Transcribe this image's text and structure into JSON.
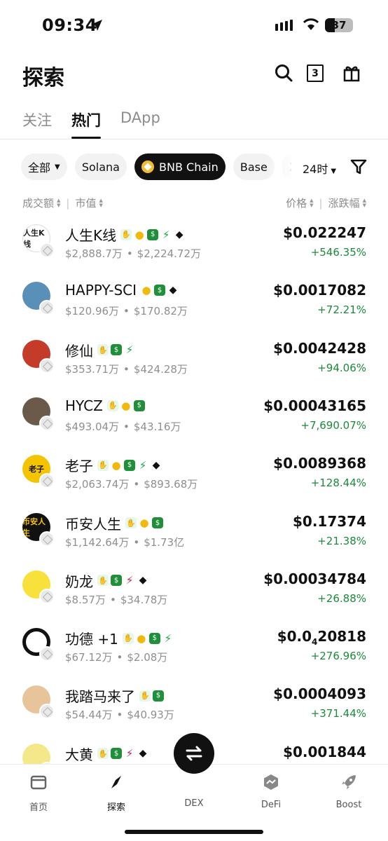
{
  "status_bar": {
    "time": "09:34",
    "battery": "37"
  },
  "header": {
    "title": "探索",
    "notification_count": "3"
  },
  "tabs": [
    {
      "label": "关注",
      "active": false
    },
    {
      "label": "热门",
      "active": true
    },
    {
      "label": "DApp",
      "active": false
    }
  ],
  "chips": [
    {
      "label": "全部"
    },
    {
      "label": "Solana"
    },
    {
      "label": "BNB Chain"
    },
    {
      "label": "Base"
    },
    {
      "label": "X"
    }
  ],
  "timeframe": "24时",
  "columns": {
    "volume": "成交额",
    "mcap": "市值",
    "price": "价格",
    "change": "涨跌幅"
  },
  "tokens": [
    {
      "name": "人生K线",
      "volume": "$2,888.7万",
      "mcap": "$2,224.72万",
      "price_main": "$0.022247",
      "price_sub": "",
      "price_tail": "",
      "change": "+546.35%",
      "avatar_text": "人生K线",
      "tags": [
        "hand-icon",
        "chef-hat-icon",
        "money-bag-icon",
        "bolt-icon",
        "owl-icon"
      ]
    },
    {
      "name": "HAPPY-SCI",
      "volume": "$120.96万",
      "mcap": "$170.82万",
      "price_main": "$0.0017082",
      "price_sub": "",
      "price_tail": "",
      "change": "+72.21%",
      "avatar_text": "",
      "tags": [
        "chef-hat-icon",
        "money-bag-icon",
        "owl-icon"
      ]
    },
    {
      "name": "修仙",
      "volume": "$353.71万",
      "mcap": "$424.28万",
      "price_main": "$0.0042428",
      "price_sub": "",
      "price_tail": "",
      "change": "+94.06%",
      "avatar_text": "",
      "tags": [
        "hand-icon",
        "money-bag-icon",
        "bolt-icon"
      ]
    },
    {
      "name": "HYCZ",
      "volume": "$493.04万",
      "mcap": "$43.16万",
      "price_main": "$0.00043165",
      "price_sub": "",
      "price_tail": "",
      "change": "+7,690.07%",
      "avatar_text": "",
      "tags": [
        "hand-icon",
        "chef-hat-icon",
        "money-bag-icon"
      ]
    },
    {
      "name": "老子",
      "volume": "$2,063.74万",
      "mcap": "$893.68万",
      "price_main": "$0.0089368",
      "price_sub": "",
      "price_tail": "",
      "change": "+128.44%",
      "avatar_text": "老子",
      "tags": [
        "hand-icon",
        "chef-hat-icon",
        "money-bag-icon",
        "bolt-icon",
        "owl-icon"
      ]
    },
    {
      "name": "币安人生",
      "volume": "$1,142.64万",
      "mcap": "$1.73亿",
      "price_main": "$0.17374",
      "price_sub": "",
      "price_tail": "",
      "change": "+21.38%",
      "avatar_text": "币安人生",
      "tags": [
        "hand-icon",
        "chef-hat-icon",
        "money-bag-icon"
      ]
    },
    {
      "name": "奶龙",
      "volume": "$8.57万",
      "mcap": "$34.78万",
      "price_main": "$0.00034784",
      "price_sub": "",
      "price_tail": "",
      "change": "+26.88%",
      "avatar_text": "",
      "tags": [
        "hand-icon",
        "money-bag-icon",
        "bolt-red-icon",
        "owl-icon"
      ]
    },
    {
      "name": "功德 +1",
      "volume": "$67.12万",
      "mcap": "$2.08万",
      "price_main": "$0.0",
      "price_sub": "4",
      "price_tail": "20818",
      "change": "+276.96%",
      "avatar_text": "",
      "tags": [
        "hand-icon",
        "chef-hat-icon",
        "money-bag-icon",
        "bolt-icon"
      ]
    },
    {
      "name": "我踏马来了",
      "volume": "$54.44万",
      "mcap": "$40.93万",
      "price_main": "$0.0004093",
      "price_sub": "",
      "price_tail": "",
      "change": "+371.44%",
      "avatar_text": "",
      "tags": [
        "hand-icon",
        "money-bag-icon"
      ]
    },
    {
      "name": "大黄",
      "volume": "",
      "mcap": "",
      "price_main": "$0.001844",
      "price_sub": "",
      "price_tail": "",
      "change": "",
      "avatar_text": "",
      "tags": [
        "hand-icon",
        "money-bag-icon",
        "bolt-red-icon",
        "owl-icon"
      ]
    }
  ],
  "bottom_nav": [
    {
      "label": "首页"
    },
    {
      "label": "探索"
    },
    {
      "label": "DEX"
    },
    {
      "label": "DeFi"
    },
    {
      "label": "Boost"
    }
  ]
}
